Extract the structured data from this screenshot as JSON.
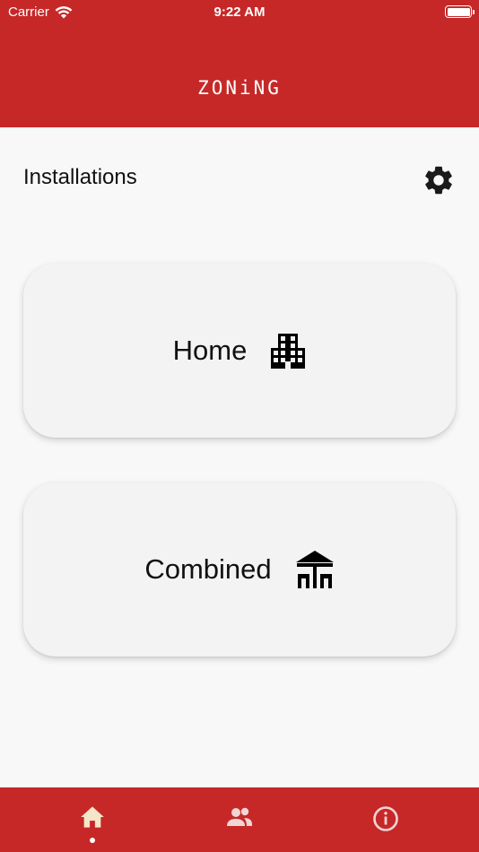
{
  "status_bar": {
    "carrier": "Carrier",
    "time": "9:22 AM",
    "battery_level": 1.0
  },
  "app": {
    "title": "ZONiNG",
    "header_color": "#c62828"
  },
  "page": {
    "section_title": "Installations",
    "settings_icon": "gear-icon"
  },
  "installations": [
    {
      "label": "Home",
      "icon": "building-icon"
    },
    {
      "label": "Combined",
      "icon": "canopy-house-icon"
    }
  ],
  "bottom_nav": {
    "items": [
      {
        "icon": "home-icon",
        "active": true
      },
      {
        "icon": "users-icon",
        "active": false
      },
      {
        "icon": "info-icon",
        "active": false
      }
    ],
    "active_color": "#f5e6c8",
    "inactive_color": "#f2d5d5"
  }
}
